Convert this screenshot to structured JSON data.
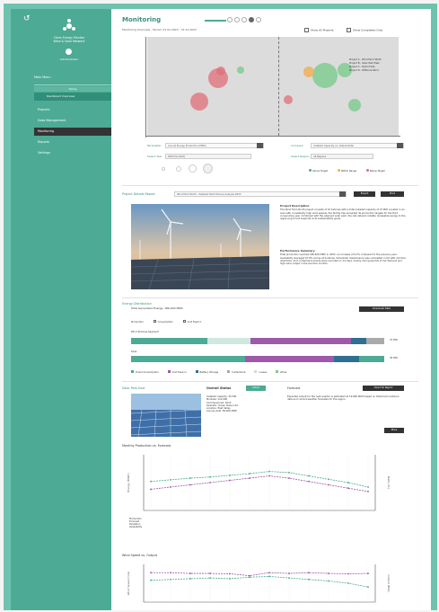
{
  "sidebar": {
    "org_name_line1": "Clean Energy Monitor",
    "org_name_line2": "Wind & Solar Network",
    "user_name": "Administrator",
    "nav_header": "Main Menu",
    "nav_sub1": "Home",
    "nav_sub2": "Dashboard Overview",
    "items": [
      {
        "label": "Projects"
      },
      {
        "label": "Data Management"
      },
      {
        "label": "Monitoring"
      },
      {
        "label": "Reports"
      },
      {
        "label": "Settings"
      }
    ]
  },
  "header": {
    "title": "Monitoring",
    "breadcrumb": "Monitoring Overview - Period: 01.01.2023 - 31.12.2023",
    "check1": "Show All Projects",
    "check2": "Show Completed Only"
  },
  "bubble_chart": {
    "legend": [
      "Project A - Wind Farm North",
      "Project B - Solar Park East",
      "Project C - Hybrid Site",
      "Project D - Offshore Wind"
    ],
    "colors": {
      "red": "#e06f78",
      "green": "#7ccb8d",
      "orange": "#f0b05a",
      "grey": "#999999"
    }
  },
  "filters": {
    "parameter_label": "Parameter",
    "parameter_value": "Annual Energy Production (MWh)",
    "compare_label": "Compare",
    "compare_value": "Installed Capacity vs. Output Ratio",
    "select_year_label": "Select Year",
    "select_year_value": "2023 (Current)",
    "select_region_label": "Select Region",
    "select_region_value": "All Regions",
    "slider_labels": [
      "Low",
      "Mid",
      "High"
    ],
    "legend": [
      "Above Target",
      "Within Range",
      "Below Target"
    ],
    "legend_colors": [
      "#4daa95",
      "#f0b05a",
      "#e06f78"
    ]
  },
  "project_detail": {
    "section_title": "Project Details Report",
    "select_value": "Wind Farm North - Detailed Performance Analysis 2023",
    "btn1": "Export",
    "btn2": "Print",
    "desc_title": "Project Description",
    "desc_text": "The Wind Farm North project consists of 24 turbines with a total installed capacity of 72 MW. Located in an area with consistently high wind speeds, the facility has exceeded its production targets for the third consecutive year. Combined with the adjacent solar park, the site delivers reliable renewable energy to the regional grid and supports local sustainability goals.",
    "perf_title": "Performance Summary",
    "perf_text": "Total production reached 186,400 MWh in 2023, an increase of 6.2% compared to the previous year. Availability averaged 97.8% across all turbines. Scheduled maintenance was completed in Q2 with minimal downtime. Grid curtailment events were recorded on 14 days, mainly during periods of low demand and high solar output in the summer months."
  },
  "distribution": {
    "section_title": "Energy Distribution",
    "subtitle": "Total Generated Energy: 186,400 MWh",
    "btn": "Download Data",
    "toggle_labels": [
      "Production",
      "Consumption",
      "Grid Feed-in"
    ],
    "bar1_label": "Wind Turbines Segment",
    "bar1_suffix": "72 MW",
    "bar2_label": "Solar",
    "bar2_suffix": "45 MW",
    "legend": [
      "Direct Consumption",
      "Grid Feed-in",
      "Battery Storage",
      "Curtailment",
      "Losses",
      "Other"
    ],
    "legend_colors": [
      "#4daa95",
      "#9e5aa8",
      "#2f6f8f",
      "#aaaaaa",
      "#d8d8d8",
      "#7ccb8d"
    ],
    "bar1": [
      {
        "value": 30,
        "color": "#4daa95"
      },
      {
        "value": 17,
        "color": "#cfe8e1"
      },
      {
        "value": 40,
        "color": "#9e5aa8"
      },
      {
        "value": 6,
        "color": "#2f6f8f"
      },
      {
        "value": 7,
        "color": "#aaaaaa"
      }
    ],
    "bar2": [
      {
        "value": 45,
        "color": "#4daa95"
      },
      {
        "value": 35,
        "color": "#9e5aa8"
      },
      {
        "value": 10,
        "color": "#2f6f8f"
      },
      {
        "value": 10,
        "color": "#4daa95"
      }
    ]
  },
  "solar_section": {
    "section_title": "Solar Park East",
    "card_title": "Overall Status",
    "tag": "Active",
    "card2_title": "Forecast",
    "btn": "View Full Report",
    "btn_small": "More",
    "info_text": "Installed capacity: 45 MW\nModules: 112,000\nCommissioned: 2019\nOperator: Green Power Ltd.\nLocation: East Valley\nAnnual yield: 58,200 MWh",
    "forecast_text": "Expected output for the next quarter is estimated at 14,800 MWh based on historical irradiance data and current weather forecasts for the region."
  },
  "chart1": {
    "title": "Monthly Production vs. Forecast",
    "ylabel": "Energy (MWh)",
    "y2label": "Ratio (%)",
    "table_rows": [
      "Production",
      "Forecast",
      "Deviation",
      "Availability"
    ]
  },
  "chart2": {
    "title": "Wind Speed vs. Output",
    "ylabel": "Wind Speed (m/s)",
    "y2label": "Output (MW)"
  },
  "chart_data": [
    {
      "type": "line",
      "title": "Monthly Production vs. Forecast",
      "xlabel": "",
      "ylabel": "Energy (MWh)",
      "x": [
        1,
        2,
        3,
        4,
        5,
        6,
        7,
        8,
        9,
        10,
        11,
        12
      ],
      "ylim": [
        0,
        100
      ],
      "series": [
        {
          "name": "Production",
          "color": "#4daa95",
          "values": [
            52,
            55,
            58,
            60,
            63,
            66,
            70,
            68,
            62,
            56,
            50,
            42
          ]
        },
        {
          "name": "Forecast",
          "color": "#9e5aa8",
          "values": [
            38,
            42,
            46,
            50,
            54,
            58,
            62,
            58,
            52,
            46,
            40,
            34
          ]
        }
      ]
    },
    {
      "type": "line",
      "title": "Wind Speed vs. Output",
      "xlabel": "",
      "ylabel": "Wind Speed (m/s)",
      "x": [
        1,
        2,
        3,
        4,
        5,
        6,
        7,
        8,
        9,
        10,
        11,
        12
      ],
      "ylim": [
        0,
        100
      ],
      "series": [
        {
          "name": "Wind Speed",
          "color": "#9e5aa8",
          "values": [
            78,
            78,
            76,
            76,
            75,
            70,
            78,
            76,
            78,
            76,
            75,
            76
          ]
        },
        {
          "name": "Output",
          "color": "#4daa95",
          "values": [
            58,
            60,
            62,
            64,
            62,
            66,
            68,
            64,
            60,
            56,
            50,
            40
          ]
        }
      ]
    }
  ]
}
